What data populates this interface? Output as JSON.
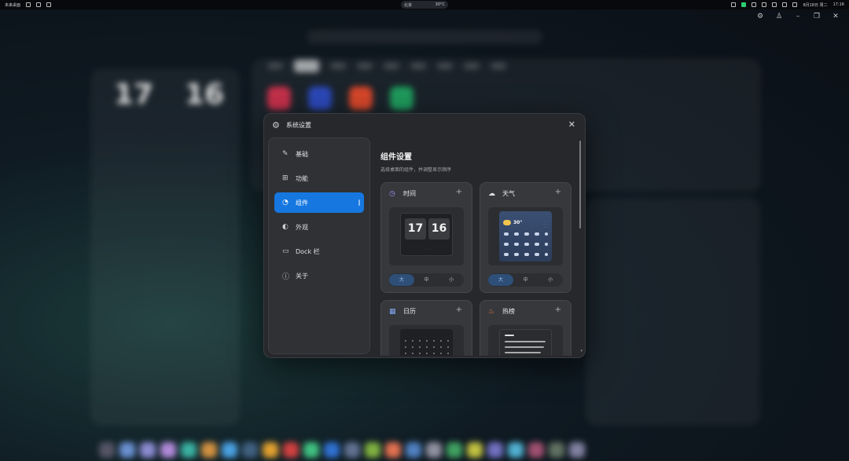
{
  "topbar": {
    "app_name": "未来桌面",
    "center_left": "北京",
    "center_right": "30°C",
    "clock": "17:16",
    "date": "8月18日 周二"
  },
  "colors": {
    "accent": "#1677e0",
    "modal_bg": "#26282c",
    "card_bg": "#36383c"
  },
  "dialog": {
    "title": "系统设置",
    "close_icon": "close-icon",
    "sidebar": [
      {
        "label": "基础",
        "icon": "wrench-icon",
        "glyph": "✎"
      },
      {
        "label": "功能",
        "icon": "grid-icon",
        "glyph": "⊞"
      },
      {
        "label": "组件",
        "icon": "widget-icon",
        "glyph": "◔"
      },
      {
        "label": "外观",
        "icon": "palette-icon",
        "glyph": "◐"
      },
      {
        "label": "Dock 栏",
        "icon": "dock-icon",
        "glyph": "▭"
      },
      {
        "label": "关于",
        "icon": "info-icon",
        "glyph": "ⓘ"
      }
    ],
    "active_index": 2,
    "content": {
      "heading": "组件设置",
      "subtitle": "选择桌面的组件，并调整显示顺序",
      "cards": [
        {
          "title": "时间",
          "icon": "clock-icon",
          "glyph": "◷",
          "preview": {
            "hour": "17",
            "minute": "16"
          },
          "sizes": [
            "大",
            "中",
            "小"
          ],
          "selected_size": 0
        },
        {
          "title": "天气",
          "icon": "cloud-icon",
          "glyph": "☁",
          "preview": {
            "temp": "30°"
          },
          "sizes": [
            "大",
            "中",
            "小"
          ],
          "selected_size": 0
        },
        {
          "title": "日历",
          "icon": "calendar-icon",
          "glyph": "▦"
        },
        {
          "title": "热榜",
          "icon": "fire-icon",
          "glyph": "♨"
        }
      ]
    }
  },
  "background": {
    "clock_hour": "17",
    "clock_minute": "16"
  }
}
